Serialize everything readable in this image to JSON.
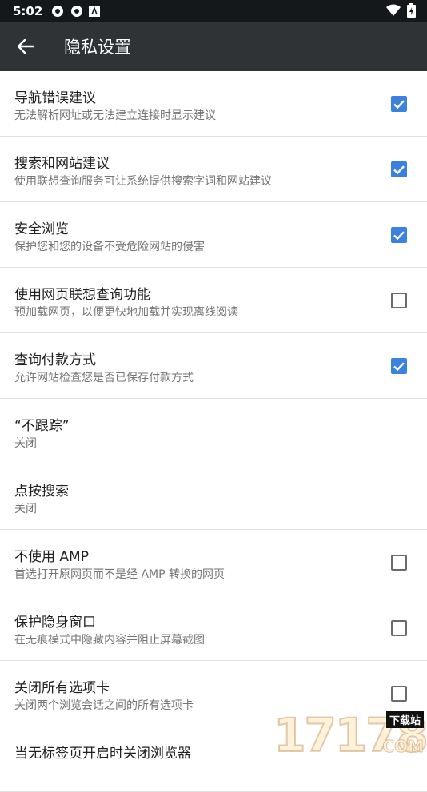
{
  "status_bar": {
    "time": "5:02"
  },
  "app_bar": {
    "title": "隐私设置"
  },
  "settings": [
    {
      "title": "导航错误建议",
      "subtitle": "无法解析网址或无法建立连接时显示建议",
      "checkbox": true,
      "checked": true
    },
    {
      "title": "搜索和网站建议",
      "subtitle": "使用联想查询服务可让系统提供搜索字词和网站建议",
      "checkbox": true,
      "checked": true
    },
    {
      "title": "安全浏览",
      "subtitle": "保护您和您的设备不受危险网站的侵害",
      "checkbox": true,
      "checked": true
    },
    {
      "title": "使用网页联想查询功能",
      "subtitle": "预加载网页，以便更快地加载并实现离线阅读",
      "checkbox": true,
      "checked": false
    },
    {
      "title": "查询付款方式",
      "subtitle": "允许网站检查您是否已保存付款方式",
      "checkbox": true,
      "checked": true
    },
    {
      "title": "“不跟踪”",
      "subtitle": "关闭",
      "checkbox": false
    },
    {
      "title": "点按搜索",
      "subtitle": "关闭",
      "checkbox": false
    },
    {
      "title": "不使用 AMP",
      "subtitle": "首选打开原网页而不是经 AMP 转换的网页",
      "checkbox": true,
      "checked": false
    },
    {
      "title": "保护隐身窗口",
      "subtitle": "在无痕模式中隐藏内容并阻止屏幕截图",
      "checkbox": true,
      "checked": false
    },
    {
      "title": "关闭所有选项卡",
      "subtitle": "关闭两个浏览会话之间的所有选项卡",
      "checkbox": true,
      "checked": false
    },
    {
      "title": "当无标签页开启时关闭浏览器",
      "subtitle": "",
      "checkbox": false
    }
  ],
  "watermark": {
    "number": "17178",
    "tag": "下载站",
    "domain": "COM"
  },
  "colors": {
    "accent": "#3b82e0",
    "appbar": "#2f3336",
    "statusbar": "#15181b"
  }
}
